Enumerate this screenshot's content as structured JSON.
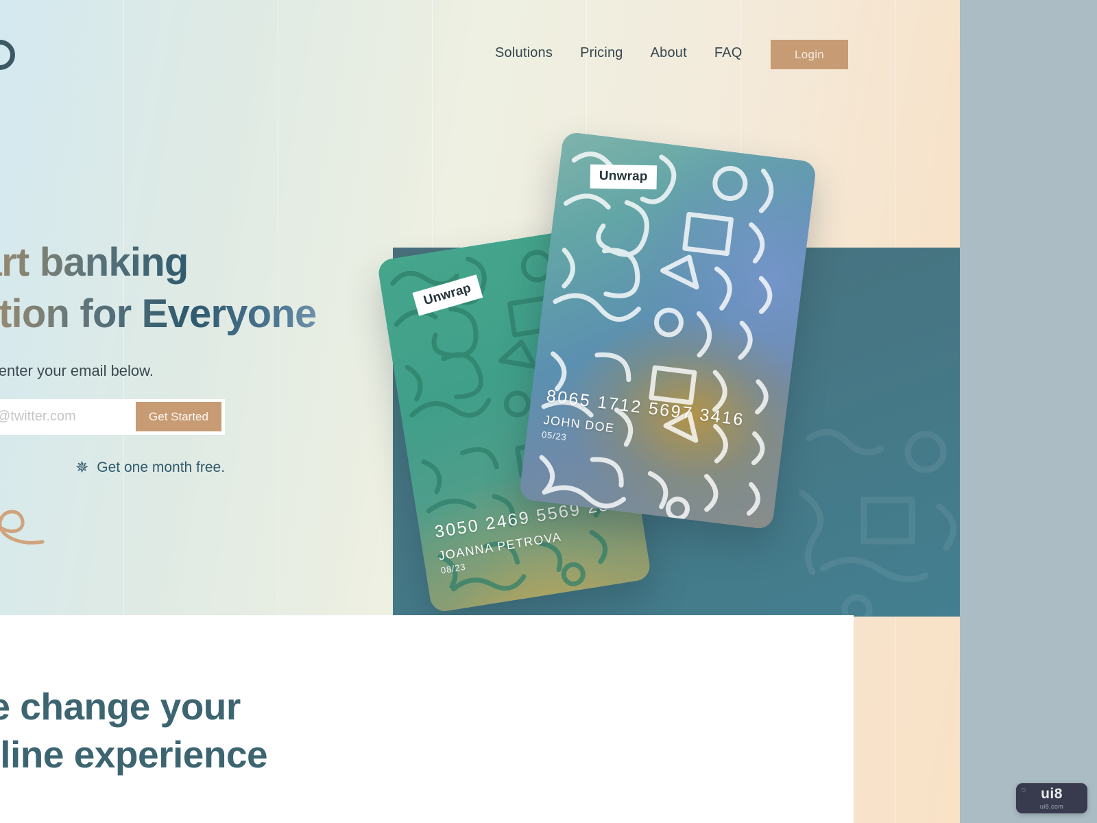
{
  "brand": {
    "name": "Unwrap",
    "logo_icon": "circle-logo-icon"
  },
  "nav": {
    "links": [
      {
        "label": "Solutions"
      },
      {
        "label": "Pricing"
      },
      {
        "label": "About"
      },
      {
        "label": "FAQ"
      }
    ],
    "login_label": "Login"
  },
  "hero": {
    "headline_line1": "Smart banking",
    "headline_line2": "solution for Everyone",
    "subcopy": "To register, enter your email below.",
    "email_placeholder": "yourname@twitter.com",
    "email_value": "",
    "cta_label": "Get Started",
    "promo_text": "Get one month free.",
    "promo_icon": "sparkle-star-icon",
    "squiggle_icon": "curved-swirl-line-icon"
  },
  "cards": [
    {
      "id": "card-front",
      "brand_tag": "Unwrap",
      "number": "8065  1712  5697  3416",
      "holder": "JOHN DOE",
      "expiry": "05/23"
    },
    {
      "id": "card-back",
      "brand_tag": "Unwrap",
      "number": "3050  2469  5569  2879",
      "holder": "JOANNA PETROVA",
      "expiry": "08/23"
    }
  ],
  "bottom_section": {
    "heading_line1": "We change your",
    "heading_line2": "online experience"
  },
  "watermark": {
    "mark": "ui8",
    "domain": "ui8.com"
  },
  "colors": {
    "accent": "#c79b74",
    "teal": "#437f90",
    "heading": "#3c6571",
    "backdrop": "#abbcc4",
    "panel_white": "#ffffff"
  }
}
